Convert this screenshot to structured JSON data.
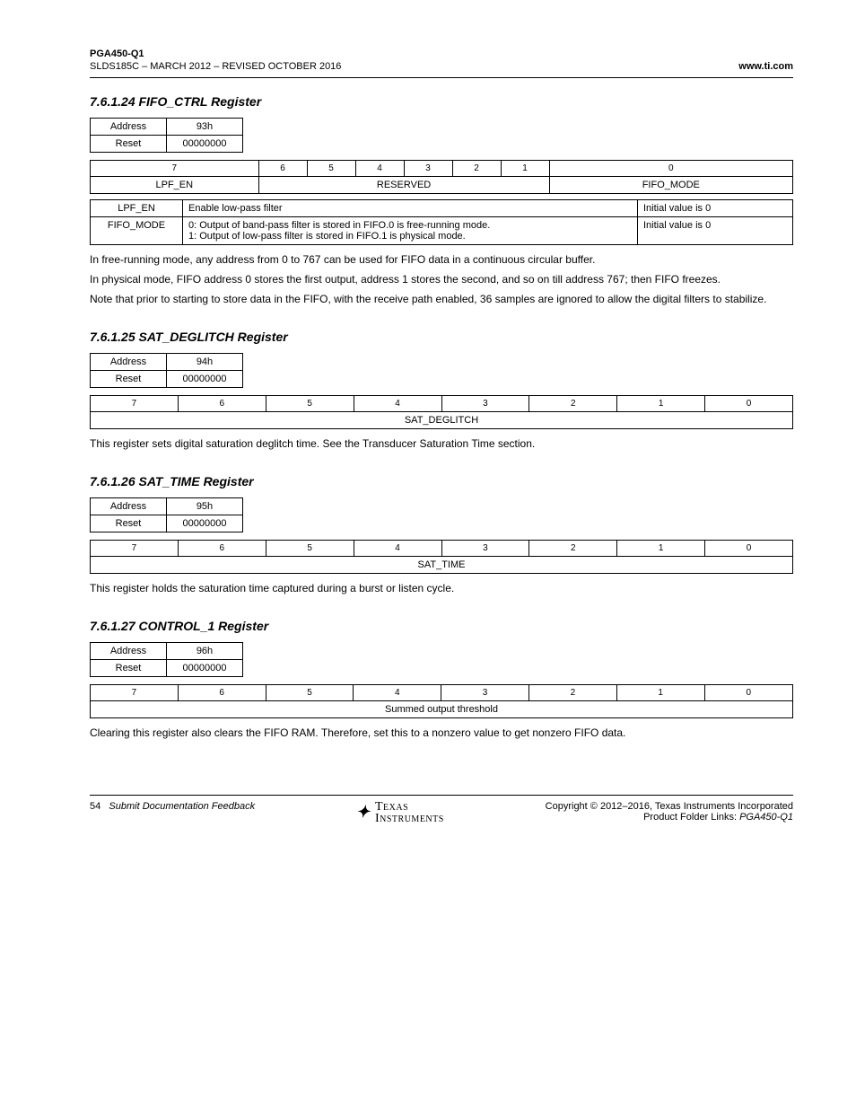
{
  "meta": {
    "part": "PGA450-Q1",
    "doc_id": "SLDS185C – MARCH 2012 – REVISED OCTOBER 2016",
    "site_link": "www.ti.com"
  },
  "sections": [
    {
      "id": "s1",
      "number": "7.6.1.24",
      "title": "FIFO_CTRL Register",
      "meta": {
        "addr_label": "Address",
        "addr": "93h",
        "reset_label": "Reset",
        "reset": "00000000"
      },
      "bits": [
        "7",
        "6",
        "5",
        "4",
        "3",
        "2",
        "1",
        "0"
      ],
      "spans": [
        {
          "cols": 1,
          "text": "LPF_EN"
        },
        {
          "cols": 6,
          "text": "RESERVED"
        },
        {
          "cols": 1,
          "text": "FIFO_MODE"
        }
      ],
      "fields": [
        {
          "name": "LPF_EN",
          "desc": "Enable low-pass filter",
          "reset": "Initial value is 0"
        },
        {
          "name": "FIFO_MODE",
          "desc": "0: Output of band-pass filter is stored in FIFO.0 is free-running mode.\n1: Output of low-pass filter is stored in FIFO.1 is physical mode.",
          "reset": "Initial value is 0"
        }
      ],
      "desc": [
        "In free-running mode, any address from 0 to 767 can be used for FIFO data in a continuous circular buffer.",
        "In physical mode, FIFO address 0 stores the first output, address 1 stores the second, and so on till address 767; then FIFO freezes.",
        "Note that prior to starting to store data in the FIFO, with the receive path enabled, 36 samples are ignored to allow the digital filters to stabilize."
      ]
    },
    {
      "id": "s2",
      "number": "7.6.1.25",
      "title": "SAT_DEGLITCH Register",
      "meta": {
        "addr_label": "Address",
        "addr": "94h",
        "reset_label": "Reset",
        "reset": "00000000"
      },
      "bits": [
        "7",
        "6",
        "5",
        "4",
        "3",
        "2",
        "1",
        "0"
      ],
      "spans": [
        {
          "cols": 8,
          "text": "SAT_DEGLITCH"
        }
      ],
      "fields": [],
      "desc": [
        "This register sets digital saturation deglitch time. See the Transducer Saturation Time section."
      ]
    },
    {
      "id": "s3",
      "number": "7.6.1.26",
      "title": "SAT_TIME Register",
      "meta": {
        "addr_label": "Address",
        "addr": "95h",
        "reset_label": "Reset",
        "reset": "00000000"
      },
      "bits": [
        "7",
        "6",
        "5",
        "4",
        "3",
        "2",
        "1",
        "0"
      ],
      "spans": [
        {
          "cols": 8,
          "text": "SAT_TIME"
        }
      ],
      "fields": [],
      "desc": [
        "This register holds the saturation time captured during a burst or listen cycle."
      ]
    },
    {
      "id": "s4",
      "number": "7.6.1.27",
      "title": "CONTROL_1 Register",
      "meta": {
        "addr_label": "Address",
        "addr": "96h",
        "reset_label": "Reset",
        "reset": "00000000"
      },
      "bits": [
        "7",
        "6",
        "5",
        "4",
        "3",
        "2",
        "1",
        "0"
      ],
      "spans": [
        {
          "cols": 8,
          "text": "Summed output threshold"
        }
      ],
      "fields": [],
      "desc": [
        "Clearing this register also clears the FIFO RAM. Therefore, set this to a nonzero value to get nonzero FIFO data."
      ]
    }
  ],
  "footer": {
    "page": "54",
    "submit_text": "Submit Documentation Feedback",
    "copyright": "Copyright © 2012–2016, Texas Instruments Incorporated",
    "product_line": "Product Folder Links:",
    "product_link": "PGA450-Q1"
  }
}
